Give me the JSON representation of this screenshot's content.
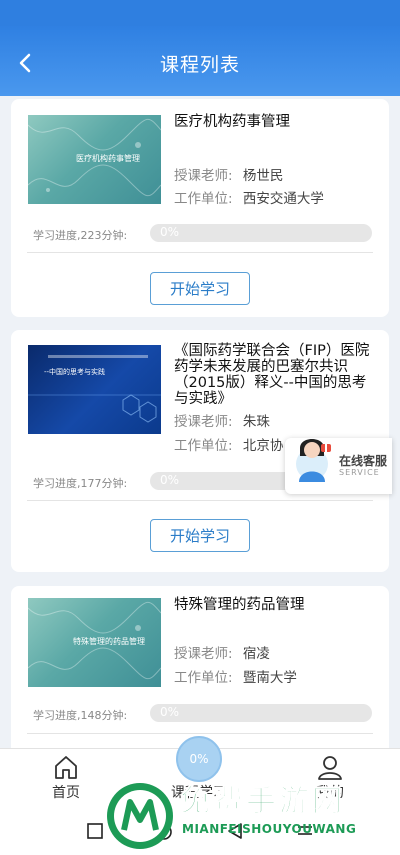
{
  "header": {
    "title": "课程列表"
  },
  "courses": [
    {
      "title": "医疗机构药事管理",
      "thumb_text": "医疗机构药事管理",
      "teacher_label": "授课老师:",
      "teacher": "杨世民",
      "unit_label": "工作单位:",
      "unit": "西安交通大学",
      "progress_label": "学习进度,223分钟:",
      "progress_value": "0%",
      "progress_fraction": 0,
      "button": "开始学习"
    },
    {
      "title": "《国际药学联合会（FIP）医院药学未来发展的巴塞尔共识（2015版）释义--中国的思考与实践》",
      "thumb_text": "--中国的思考与实践",
      "teacher_label": "授课老师:",
      "teacher": "朱珠",
      "unit_label": "工作单位:",
      "unit": "北京协",
      "progress_label": "学习进度,177分钟:",
      "progress_value": "0%",
      "progress_fraction": 0,
      "button": "开始学习"
    },
    {
      "title": "特殊管理的药品管理",
      "thumb_text": "特殊管理的药品管理",
      "teacher_label": "授课老师:",
      "teacher": "宿凌",
      "unit_label": "工作单位:",
      "unit": "暨南大学",
      "progress_label": "学习进度,148分钟:",
      "progress_value": "0%",
      "progress_fraction": 0
    }
  ],
  "service": {
    "label": "在线客服",
    "sub": "SERVICE"
  },
  "tabbar": {
    "tabs": [
      {
        "label": "首页",
        "icon": "home-icon"
      },
      {
        "label": "课程学习",
        "icon": "course-progress-icon"
      },
      {
        "label": "我的",
        "icon": "user-icon"
      }
    ],
    "progress_circle": "0%"
  },
  "watermark": {
    "title": "免费手游网",
    "sub": "MIANFEISHOUYOUWANG"
  },
  "colors": {
    "header": "#2f80e2",
    "accent": "#2a7cc8",
    "watermark": "#1d9b56"
  }
}
